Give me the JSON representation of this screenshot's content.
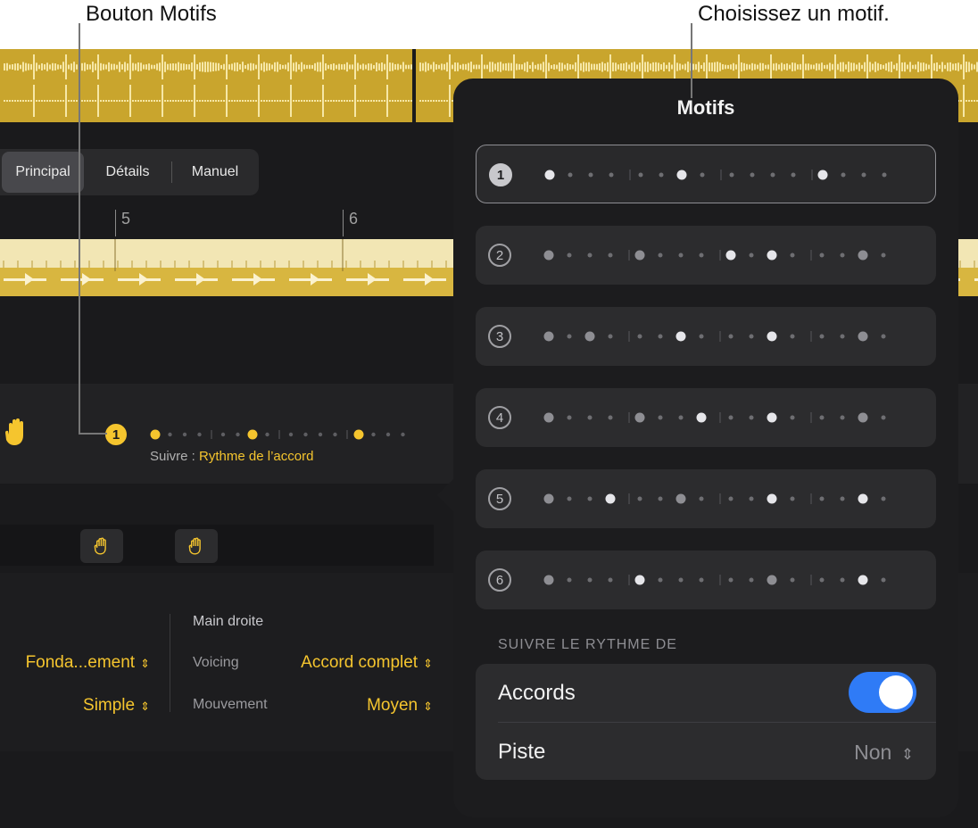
{
  "callouts": {
    "left": "Bouton Motifs",
    "right": "Choisissez un motif."
  },
  "tabs": [
    "Principal",
    "Détails",
    "Manuel"
  ],
  "ruler": [
    "5",
    "6"
  ],
  "pattern_button": {
    "number": "1",
    "follow_label": "Suivre : ",
    "follow_value": "Rythme de l’accord"
  },
  "settings": {
    "right_hand_header": "Main droite",
    "left_col": {
      "value1": "Fonda...ement",
      "value2": "Simple"
    },
    "right_col": {
      "voicing_label": "Voicing",
      "voicing_value": "Accord complet",
      "movement_label": "Mouvement",
      "movement_value": "Moyen"
    }
  },
  "popover": {
    "title": "Motifs",
    "motifs": [
      {
        "number": "1",
        "selected": true
      },
      {
        "number": "2",
        "selected": false
      },
      {
        "number": "3",
        "selected": false
      },
      {
        "number": "4",
        "selected": false
      },
      {
        "number": "5",
        "selected": false
      },
      {
        "number": "6",
        "selected": false
      }
    ],
    "section_header": "SUIVRE LE RYTHME DE",
    "chords_label": "Accords",
    "chords_on": true,
    "track_label": "Piste",
    "track_value": "Non"
  },
  "colors": {
    "accent_yellow": "#f5c52e",
    "toggle_blue": "#2f7bf6",
    "region_gold": "#c9a52d"
  }
}
